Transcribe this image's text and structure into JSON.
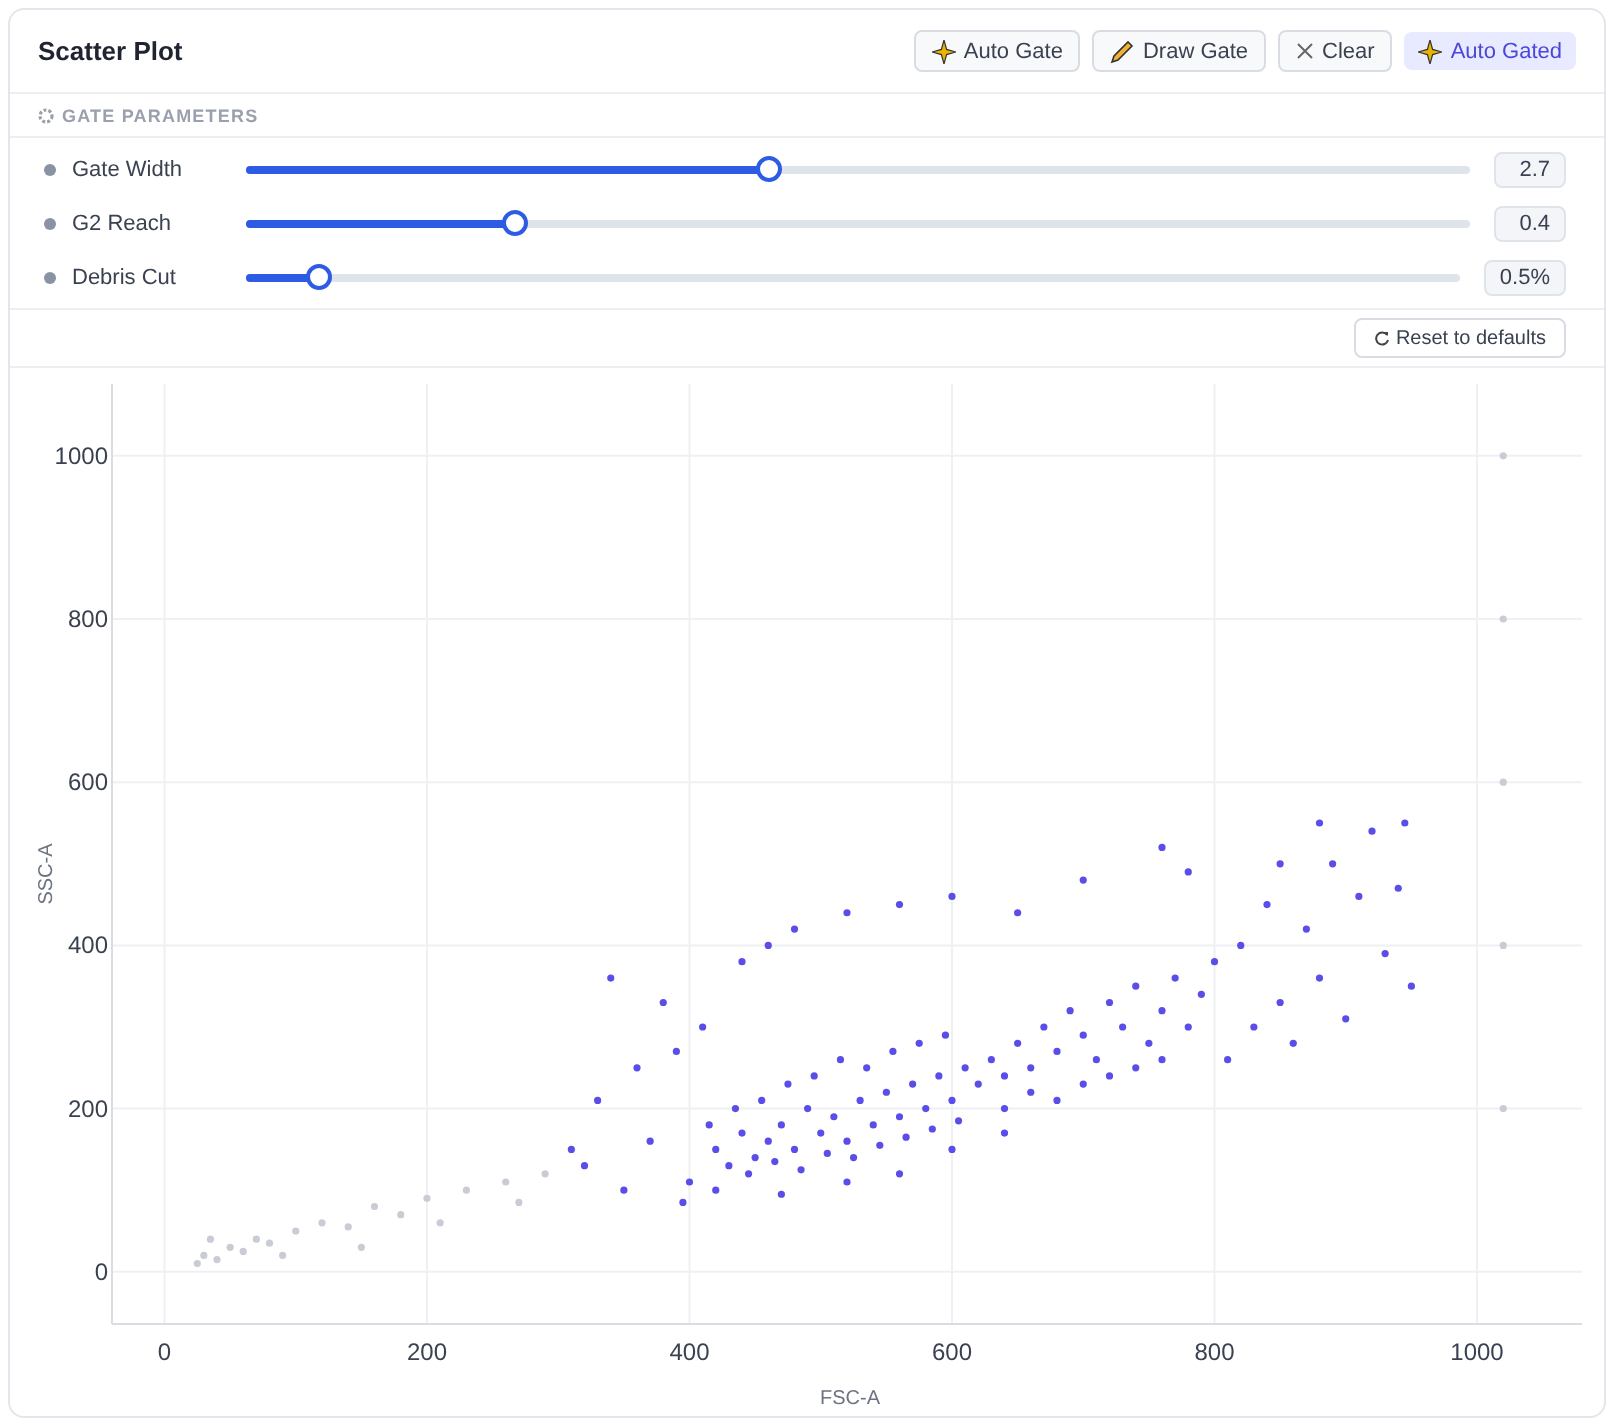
{
  "header": {
    "title": "Scatter Plot",
    "buttons": [
      {
        "label": "Auto Gate",
        "kind": "sparkle"
      },
      {
        "label": "Draw Gate",
        "kind": "pencil"
      },
      {
        "label": "Clear",
        "kind": "close"
      }
    ],
    "badge": {
      "label": "Auto Gated",
      "kind": "sparkle"
    }
  },
  "parameters": {
    "title": "GATE PARAMETERS",
    "sliders": [
      {
        "label": "Gate Width",
        "level": 0.426,
        "reading": "2.7"
      },
      {
        "label": "G2 Reach",
        "level": 0.219,
        "reading": "0.4"
      },
      {
        "label": "Debris Cut",
        "level": 0.059,
        "reading": "0.5%"
      }
    ],
    "reset": "Reset to defaults"
  },
  "plot": {
    "chart_data": {
      "type": "scatter",
      "grid": true,
      "xlabel": "FSC-A",
      "ylabel": "SSC-A",
      "xlim": [
        -40,
        1080
      ],
      "ylim": [
        -64,
        1088
      ],
      "xticks": [
        0,
        200,
        400,
        600,
        800,
        1000
      ],
      "yticks": [
        0,
        200,
        400,
        600,
        800,
        1000
      ],
      "series": [
        {
          "color": "#5b4ee8",
          "x": [
            420,
            440,
            450,
            460,
            470,
            480,
            490,
            500,
            510,
            520,
            530,
            540,
            550,
            560,
            570,
            580,
            590,
            600,
            610,
            620,
            430,
            445,
            465,
            485,
            505,
            525,
            545,
            565,
            585,
            605,
            415,
            435,
            455,
            475,
            495,
            515,
            535,
            555,
            575,
            595,
            630,
            640,
            650,
            660,
            670,
            680,
            690,
            700,
            710,
            720,
            730,
            740,
            750,
            760,
            770,
            780,
            790,
            800,
            640,
            660,
            680,
            700,
            720,
            740,
            760,
            810,
            820,
            830,
            840,
            850,
            860,
            870,
            880,
            890,
            900,
            910,
            920,
            930,
            940,
            950,
            945,
            880,
            850,
            320,
            330,
            340,
            360,
            370,
            380,
            390,
            400,
            410,
            440,
            460,
            480,
            520,
            560,
            600,
            650,
            700,
            760,
            780,
            310,
            350,
            395,
            420,
            470,
            520,
            560,
            600,
            640
          ],
          "values": [
            150,
            170,
            140,
            160,
            180,
            150,
            200,
            170,
            190,
            160,
            210,
            180,
            220,
            190,
            230,
            200,
            240,
            210,
            250,
            230,
            130,
            120,
            135,
            125,
            145,
            140,
            155,
            165,
            175,
            185,
            180,
            200,
            210,
            230,
            240,
            260,
            250,
            270,
            280,
            290,
            260,
            240,
            280,
            250,
            300,
            270,
            320,
            290,
            260,
            330,
            300,
            350,
            280,
            320,
            360,
            300,
            340,
            380,
            200,
            220,
            210,
            230,
            240,
            250,
            260,
            260,
            400,
            300,
            450,
            330,
            280,
            420,
            360,
            500,
            310,
            460,
            540,
            390,
            470,
            350,
            550,
            550,
            500,
            130,
            210,
            360,
            250,
            160,
            330,
            270,
            110,
            300,
            380,
            400,
            420,
            440,
            450,
            460,
            440,
            480,
            520,
            490,
            150,
            100,
            85,
            100,
            95,
            110,
            120,
            150,
            170
          ]
        },
        {
          "color": "#c9ccd4",
          "x": [
            25,
            30,
            40,
            50,
            60,
            70,
            80,
            100,
            120,
            140,
            160,
            180,
            200,
            230,
            260,
            290,
            35,
            90,
            150,
            210,
            270,
            1020,
            1020,
            1020,
            1020,
            1020
          ],
          "values": [
            10,
            20,
            15,
            30,
            25,
            40,
            35,
            50,
            60,
            55,
            80,
            70,
            90,
            100,
            110,
            120,
            40,
            20,
            30,
            60,
            85,
            200,
            400,
            600,
            800,
            1000
          ]
        }
      ]
    }
  }
}
